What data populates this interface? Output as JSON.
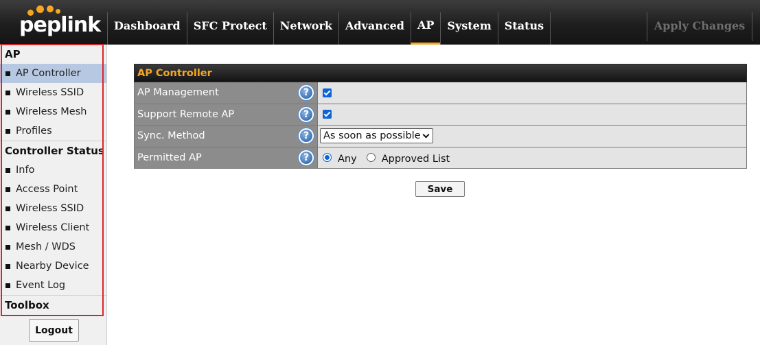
{
  "brand": {
    "logo_text": "peplink",
    "accent": "#f5a623"
  },
  "nav": {
    "items": [
      {
        "label": "Dashboard"
      },
      {
        "label": "SFC Protect"
      },
      {
        "label": "Network"
      },
      {
        "label": "Advanced"
      },
      {
        "label": "AP",
        "active": true
      },
      {
        "label": "System"
      },
      {
        "label": "Status"
      }
    ],
    "apply_label": "Apply Changes"
  },
  "sidebar": {
    "sections": [
      {
        "title": "AP",
        "items": [
          "AP Controller",
          "Wireless SSID",
          "Wireless Mesh",
          "Profiles"
        ]
      },
      {
        "title": "Controller Status",
        "items": [
          "Info",
          "Access Point",
          "Wireless SSID",
          "Wireless Client",
          "Mesh / WDS",
          "Nearby Device",
          "Event Log"
        ]
      },
      {
        "title": "Toolbox",
        "items": []
      }
    ],
    "active_item": "AP Controller",
    "logout_label": "Logout"
  },
  "panel": {
    "title": "AP Controller",
    "rows": [
      {
        "label": "AP Management",
        "type": "checkbox",
        "checked": true
      },
      {
        "label": "Support Remote AP",
        "type": "checkbox",
        "checked": true
      },
      {
        "label": "Sync. Method",
        "type": "select",
        "value": "As soon as possible"
      },
      {
        "label": "Permitted AP",
        "type": "radio",
        "options": [
          "Any",
          "Approved List"
        ],
        "selected": "Any"
      }
    ],
    "help_glyph": "?",
    "save_label": "Save"
  }
}
